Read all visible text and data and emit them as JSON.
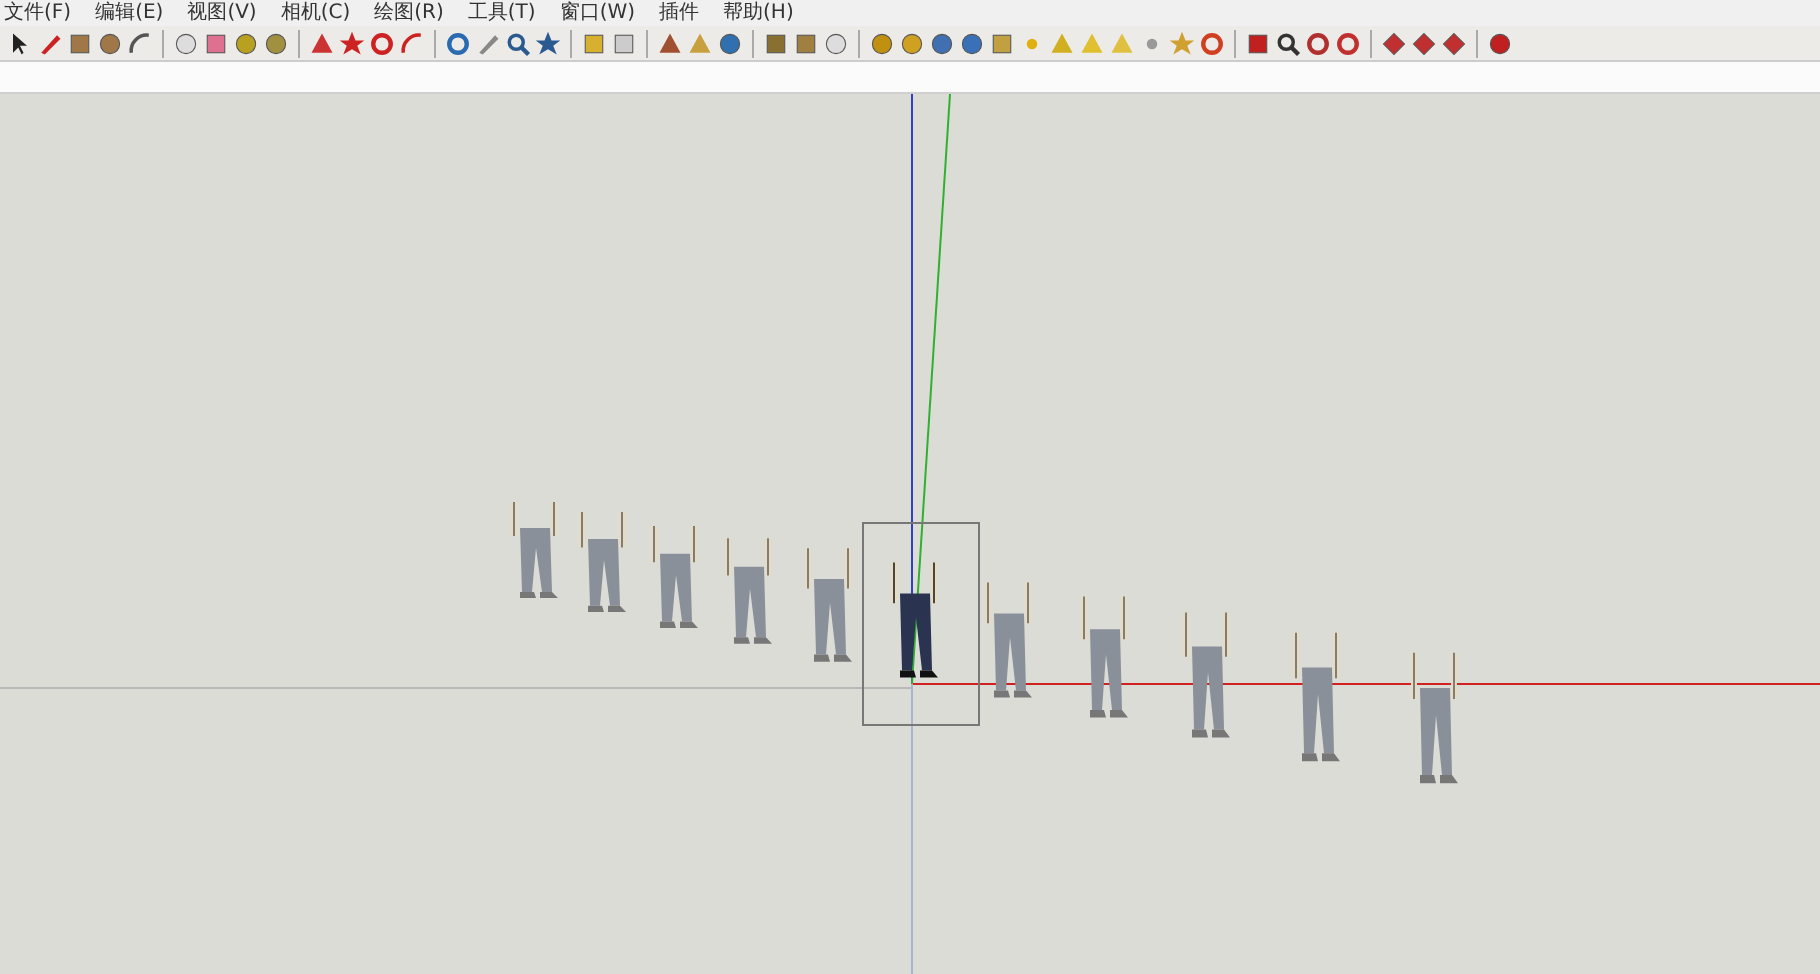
{
  "menu": [
    {
      "label": "文件(F)"
    },
    {
      "label": "编辑(E)"
    },
    {
      "label": "视图(V)"
    },
    {
      "label": "相机(C)"
    },
    {
      "label": "绘图(R)"
    },
    {
      "label": "工具(T)"
    },
    {
      "label": "窗口(W)"
    },
    {
      "label": "插件"
    },
    {
      "label": "帮助(H)"
    }
  ],
  "scene": {
    "figures": [
      {
        "selected": false
      },
      {
        "selected": false
      },
      {
        "selected": false
      },
      {
        "selected": false
      },
      {
        "selected": false
      },
      {
        "selected": true
      },
      {
        "selected": false
      },
      {
        "selected": false
      },
      {
        "selected": false
      },
      {
        "selected": false
      },
      {
        "selected": false
      }
    ]
  }
}
